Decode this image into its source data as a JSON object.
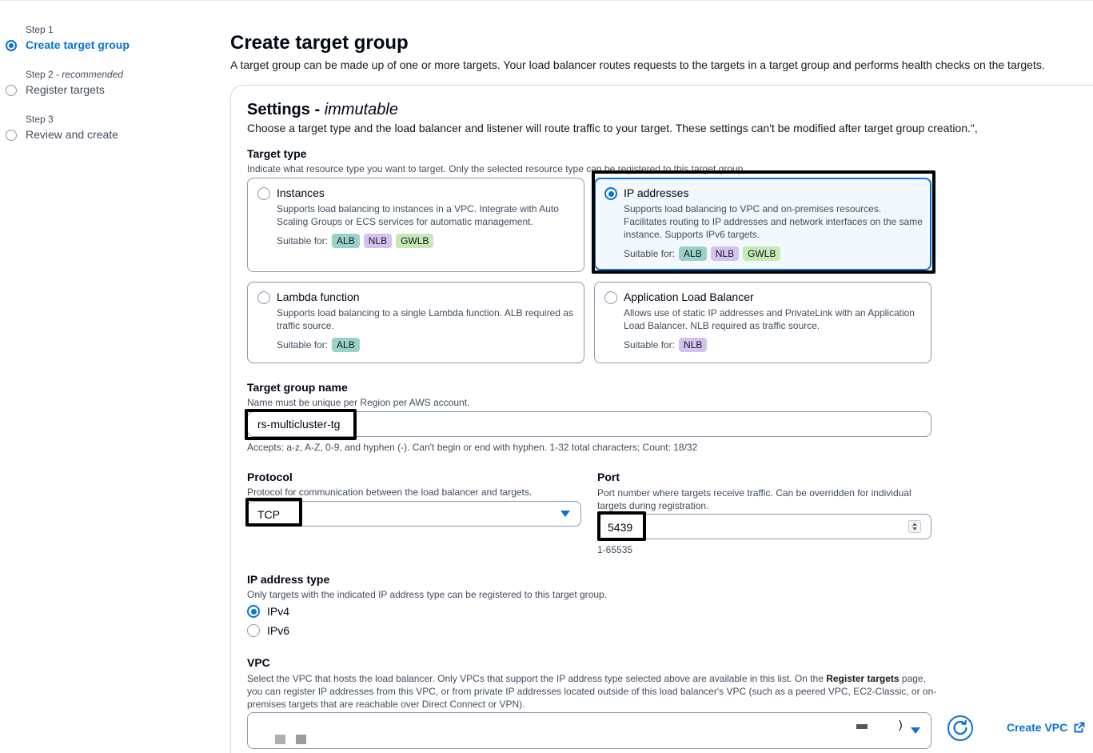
{
  "steps": [
    {
      "num": "Step 1",
      "label": "Create target group"
    },
    {
      "num": "Step 2",
      "num_suffix": "recommended",
      "label": "Register targets"
    },
    {
      "num": "Step 3",
      "label": "Review and create"
    }
  ],
  "header": {
    "title": "Create target group",
    "description": "A target group can be made up of one or more targets. Your load balancer routes requests to the targets in a target group and performs health checks on the targets."
  },
  "settings": {
    "title": "Settings",
    "title_suffix": "immutable",
    "description": "Choose a target type and the load balancer and listener will route traffic to your target. These settings can't be modified after target group creation.\","
  },
  "target_type": {
    "label": "Target type",
    "description": "Indicate what resource type you want to target. Only the selected resource type can be registered to this target group.",
    "suitable_label": "Suitable for:",
    "options": [
      {
        "title": "Instances",
        "desc": "Supports load balancing to instances in a VPC. Integrate with Auto Scaling Groups or ECS services for automatic management.",
        "badges": [
          "ALB",
          "NLB",
          "GWLB"
        ],
        "selected": false
      },
      {
        "title": "IP addresses",
        "desc": "Supports load balancing to VPC and on-premises resources. Facilitates routing to IP addresses and network interfaces on the same instance. Supports IPv6 targets.",
        "badges": [
          "ALB",
          "NLB",
          "GWLB"
        ],
        "selected": true
      },
      {
        "title": "Lambda function",
        "desc": "Supports load balancing to a single Lambda function. ALB required as traffic source.",
        "badges": [
          "ALB"
        ],
        "selected": false
      },
      {
        "title": "Application Load Balancer",
        "desc": "Allows use of static IP addresses and PrivateLink with an Application Load Balancer. NLB required as traffic source.",
        "badges": [
          "NLB"
        ],
        "selected": false
      }
    ]
  },
  "name_field": {
    "label": "Target group name",
    "description": "Name must be unique per Region per AWS account.",
    "value": "rs-multicluster-tg",
    "constraint": "Accepts: a-z, A-Z, 0-9, and hyphen (-). Can't begin or end with hyphen. 1-32 total characters; Count: 18/32"
  },
  "protocol": {
    "label": "Protocol",
    "description": "Protocol for communication between the load balancer and targets.",
    "value": "TCP"
  },
  "port": {
    "label": "Port",
    "description": "Port number where targets receive traffic. Can be overridden for individual targets during registration.",
    "value": "5439",
    "constraint": "1-65535"
  },
  "ip_type": {
    "label": "IP address type",
    "description": "Only targets with the indicated IP address type can be registered to this target group.",
    "options": [
      "IPv4",
      "IPv6"
    ],
    "selected": "IPv4"
  },
  "vpc": {
    "label": "VPC",
    "desc_part1": "Select the VPC that hosts the load balancer. Only VPCs that support the IP address type selected above are available in this list. On the ",
    "desc_bold": "Register targets",
    "desc_part2": " page, you can register IP addresses from this VPC, or from private IP addresses located outside of this load balancer's VPC (such as a peered VPC, EC2-Classic, or on-premises targets that are reachable over Direct Connect or VPN).",
    "value_suffix": ")",
    "create_label": "Create VPC"
  },
  "colors": {
    "accent": "#0972d3",
    "alb": "#99d1c9",
    "nlb": "#d3c2ef",
    "gwlb": "#c5e8b7"
  }
}
